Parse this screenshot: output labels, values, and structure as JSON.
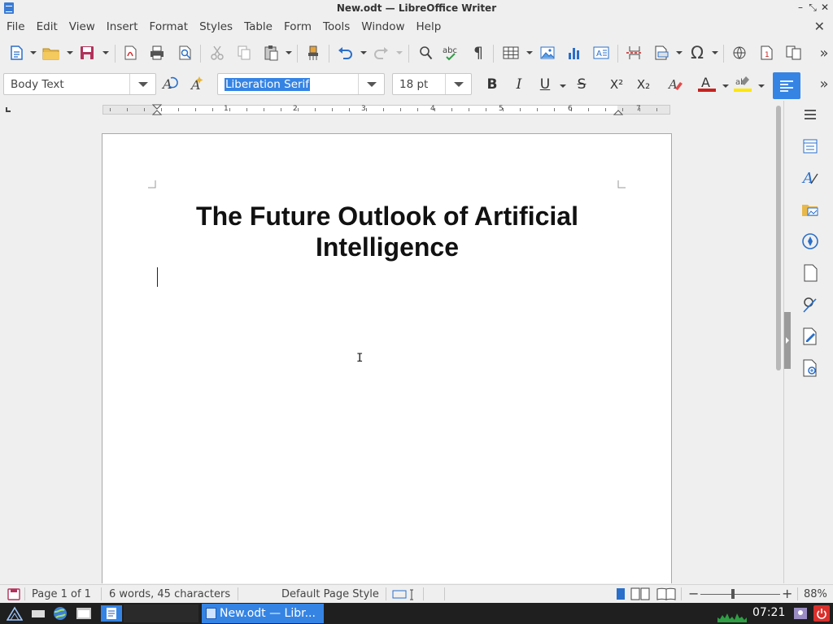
{
  "window": {
    "title": "New.odt — LibreOffice Writer",
    "controls": [
      "–",
      "⤡",
      "✕"
    ]
  },
  "menu": {
    "items": [
      "File",
      "Edit",
      "View",
      "Insert",
      "Format",
      "Styles",
      "Table",
      "Form",
      "Tools",
      "Window",
      "Help"
    ],
    "close_doc": "✕"
  },
  "formatting": {
    "paragraph_style": "Body Text",
    "font_name": "Liberation Serif",
    "font_size": "18 pt",
    "bold": "B",
    "italic": "I",
    "underline": "U",
    "strike": "S",
    "superscript": "X²",
    "subscript": "X₂"
  },
  "ruler": {
    "numbers": [
      "1",
      "2",
      "3",
      "4",
      "5",
      "6",
      "7"
    ]
  },
  "document": {
    "title_line1": "The Future Outlook of Artificial",
    "title_line2": "Intelligence"
  },
  "status": {
    "page": "Page 1 of 1",
    "words": "6 words, 45 characters",
    "page_style": "Default Page Style",
    "zoom": "88%"
  },
  "taskbar": {
    "active_window": "New.odt — Libr...",
    "clock": "07:21"
  },
  "colors": {
    "accent": "#3584e4",
    "font_color": "#c9211e",
    "highlight": "#ffe600"
  }
}
